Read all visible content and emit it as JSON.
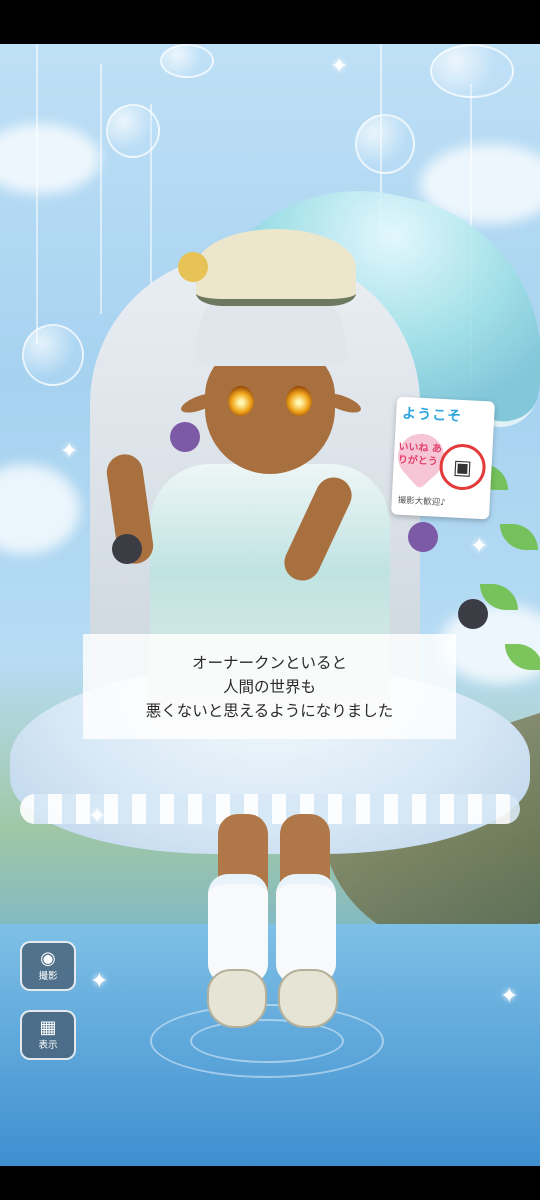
{
  "dialog": {
    "line1": "オーナークンといると",
    "line2": "人間の世界も",
    "line3": "悪くないと思えるようになりました"
  },
  "welcome_card": {
    "title": "ようこそ",
    "thanks": "いいね ありがとう",
    "footer": "撮影大歓迎♪",
    "icon": "camera-icon"
  },
  "buttons": {
    "photo_label": "撮影",
    "photo_icon": "camera-icon",
    "display_label": "表示",
    "display_icon": "dashed-square-icon"
  },
  "colors": {
    "sky": "#a6d2f0",
    "dialog_bg": "rgba(255,255,255,0.82)",
    "welcome_accent": "#2aa5e0",
    "thanks_pink": "#e0406c"
  }
}
